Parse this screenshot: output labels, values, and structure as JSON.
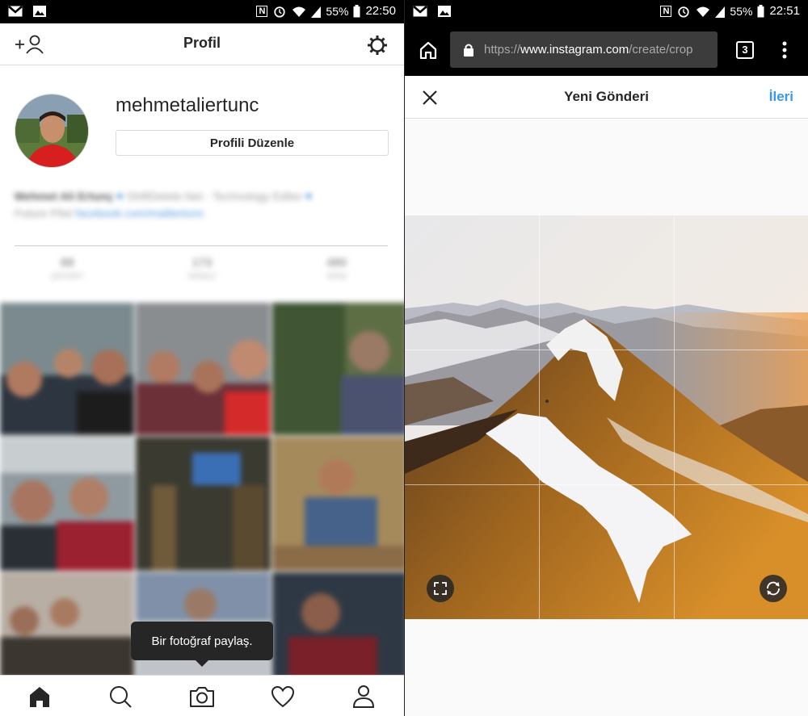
{
  "left_screen": {
    "status_bar": {
      "nfc": "N",
      "battery": "55%",
      "time": "22:50"
    },
    "top_bar": {
      "title": "Profil",
      "add_person_icon": "add-person-icon",
      "settings_icon": "gear-icon"
    },
    "profile": {
      "username": "mehmetaliertunc",
      "edit_profile_label": "Profili Düzenle",
      "bio_name": "Mehmet Ali Ertunç",
      "bio_text": "ShiftDelete.Net - Technology Editor",
      "bio_line2": "Future Pilot",
      "bio_link": "facebook.com/malitertunc",
      "stats": [
        {
          "value": "88",
          "label": "gönderi"
        },
        {
          "value": "173",
          "label": "takipçi"
        },
        {
          "value": "480",
          "label": "takip"
        }
      ]
    },
    "tooltip": "Bir fotoğraf paylaş.",
    "bottom_nav": [
      {
        "name": "home-icon",
        "active": true
      },
      {
        "name": "search-icon",
        "active": false
      },
      {
        "name": "camera-icon",
        "active": false
      },
      {
        "name": "heart-icon",
        "active": false
      },
      {
        "name": "profile-icon",
        "active": false
      }
    ]
  },
  "right_screen": {
    "status_bar": {
      "nfc": "N",
      "battery": "55%",
      "time": "22:51"
    },
    "browser": {
      "url_prefix": "https://",
      "url_domain": "www.instagram.com",
      "url_path": "/create/crop",
      "tab_count": "3"
    },
    "post_header": {
      "title": "Yeni Gönderi",
      "next_label": "İleri"
    },
    "colors": {
      "accent": "#3897f0"
    }
  }
}
